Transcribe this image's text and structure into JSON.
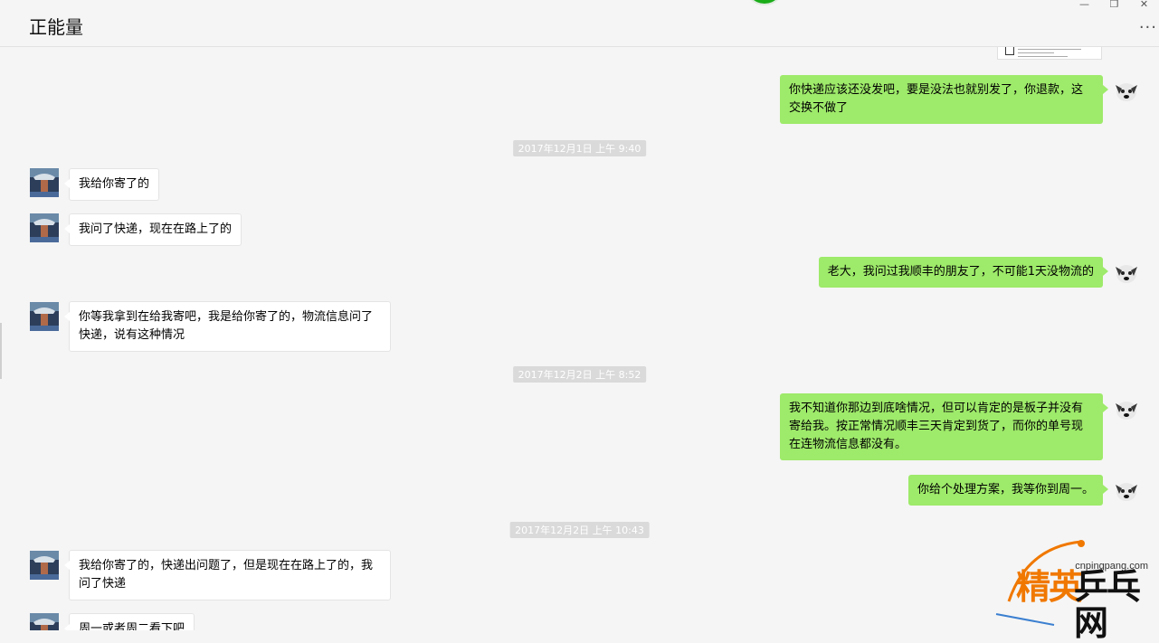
{
  "window": {
    "title": "正能量",
    "minimize": "—",
    "restore": "❐",
    "close": "✕",
    "more": "···"
  },
  "watermark": {
    "url": "cnpingpang.com",
    "text_orange": "精英",
    "text_black": "乒乓网"
  },
  "messages": [
    {
      "type": "out",
      "text": "你快递应该还没发吧，要是没法也就别发了，你退款，这交换不做了"
    },
    {
      "type": "time",
      "text": "2017年12月1日 上午 9:40"
    },
    {
      "type": "in",
      "text": "我给你寄了的"
    },
    {
      "type": "in",
      "text": "我问了快递，现在在路上了的"
    },
    {
      "type": "out",
      "text": "老大，我问过我顺丰的朋友了，不可能1天没物流的"
    },
    {
      "type": "in",
      "text": "你等我拿到在给我寄吧，我是给你寄了的，物流信息问了快递，说有这种情况"
    },
    {
      "type": "time",
      "text": "2017年12月2日 上午 8:52"
    },
    {
      "type": "out",
      "text": "我不知道你那边到底啥情况，但可以肯定的是板子并没有寄给我。按正常情况顺丰三天肯定到货了，而你的单号现在连物流信息都没有。"
    },
    {
      "type": "out",
      "text": "你给个处理方案，我等你到周一。"
    },
    {
      "type": "time",
      "text": "2017年12月2日 上午 10:43"
    },
    {
      "type": "in",
      "text": "我给你寄了的，快递出问题了，但是现在在路上了的，我问了快递"
    },
    {
      "type": "in",
      "text": "周一或者周二看下吧"
    }
  ]
}
